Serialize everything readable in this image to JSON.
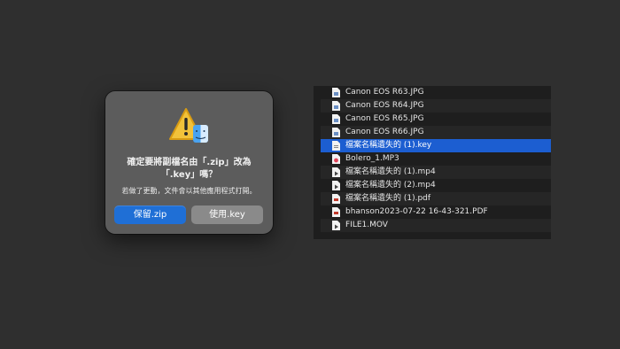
{
  "dialog": {
    "title_line1": "確定要將副檔名由「.zip」改為",
    "title_line2": "「.key」嗎？",
    "message": "若做了更動，文件會以其他應用程式打開。",
    "keep_button": "保留.zip",
    "use_button": "使用.key",
    "icon": "warning-finder-icon"
  },
  "files": [
    {
      "name": "Canon EOS R63.JPG",
      "icon": "image-file-icon"
    },
    {
      "name": "Canon EOS R64.JPG",
      "icon": "image-file-icon"
    },
    {
      "name": "Canon EOS R65.JPG",
      "icon": "image-file-icon"
    },
    {
      "name": "Canon EOS R66.JPG",
      "icon": "image-file-icon"
    },
    {
      "name": "檔案名稱遺失的 (1).key",
      "icon": "document-file-icon",
      "selected": true
    },
    {
      "name": "Bolero_1.MP3",
      "icon": "audio-file-icon"
    },
    {
      "name": "檔案名稱遺失的 (1).mp4",
      "icon": "video-file-icon"
    },
    {
      "name": "檔案名稱遺失的 (2).mp4",
      "icon": "video-file-icon"
    },
    {
      "name": "檔案名稱遺失的 (1).pdf",
      "icon": "pdf-file-icon"
    },
    {
      "name": "bhanson2023-07-22 16-43-321.PDF",
      "icon": "pdf-file-icon"
    },
    {
      "name": "FILE1.MOV",
      "icon": "video-file-icon"
    }
  ],
  "colors": {
    "selection": "#1c5ed1",
    "primary_button": "#1f6fd6",
    "dialog_bg": "#5c5c5c"
  }
}
